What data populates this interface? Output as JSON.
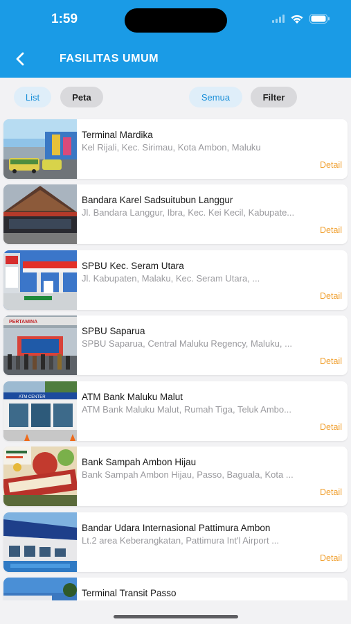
{
  "status": {
    "time": "1:59"
  },
  "header": {
    "title": "FASILITAS UMUM"
  },
  "tabs": {
    "list": "List",
    "map": "Peta",
    "all": "Semua",
    "filter": "Filter"
  },
  "items": [
    {
      "title": "Terminal Mardika",
      "address": "Kel Rijali, Kec. Sirimau, Kota Ambon, Maluku",
      "detail": "Detail"
    },
    {
      "title": "Bandara Karel Sadsuitubun Langgur",
      "address": "Jl. Bandara Langgur, Ibra, Kec. Kei Kecil, Kabupate...",
      "detail": "Detail"
    },
    {
      "title": "SPBU Kec. Seram Utara",
      "address": "Jl. Kabupaten, Malaku, Kec. Seram Utara, ...",
      "detail": "Detail"
    },
    {
      "title": "SPBU Saparua",
      "address": "SPBU Saparua, Central Maluku Regency, Maluku, ...",
      "detail": "Detail"
    },
    {
      "title": "ATM Bank Maluku Malut",
      "address": "ATM Bank Maluku Malut, Rumah Tiga, Teluk Ambo...",
      "detail": "Detail"
    },
    {
      "title": "Bank Sampah Ambon Hijau",
      "address": "Bank Sampah Ambon Hijau, Passo, Baguala, Kota ...",
      "detail": "Detail"
    },
    {
      "title": "Bandar Udara Internasional Pattimura Ambon",
      "address": "Lt.2 area Keberangkatan, Pattimura Int'l Airport ...",
      "detail": "Detail"
    },
    {
      "title": "Terminal Transit Passo",
      "address": "",
      "detail": ""
    }
  ],
  "thumb_text": {
    "pertamina": "PERTAMINA",
    "atm": "ATM CENTER"
  }
}
